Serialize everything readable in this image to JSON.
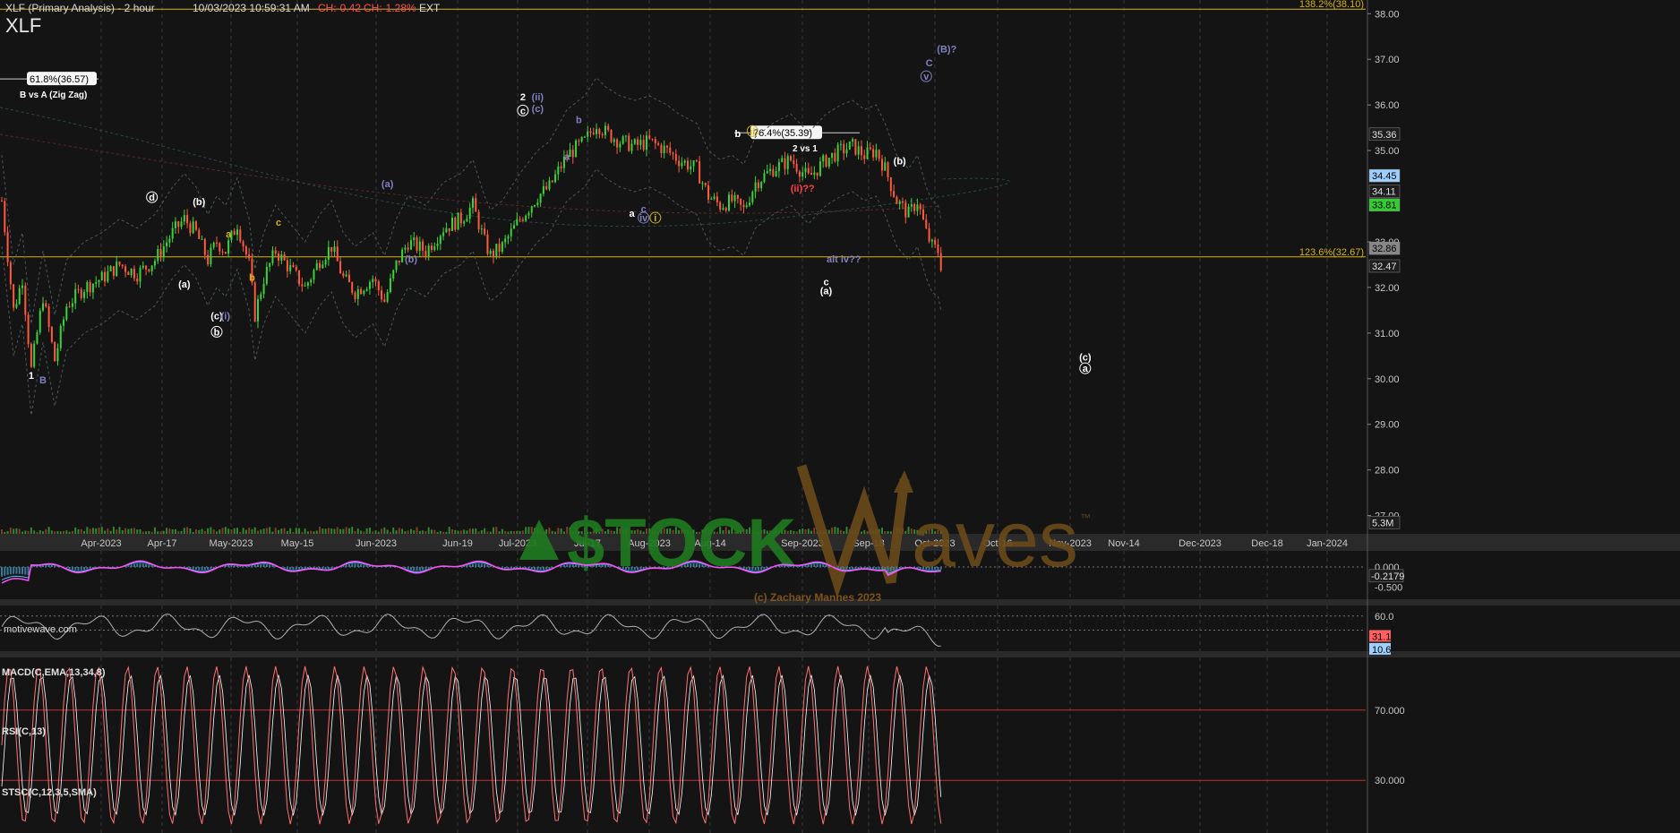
{
  "header": {
    "title": "XLF (Primary Analysis) - 2 hour",
    "timestamp": "10/03/2023 10:59:31 AM",
    "change": "CH:-0.42",
    "change_pct": "CH:-1.28%",
    "session": "EXT",
    "symbol": "XLF"
  },
  "colors": {
    "background": "#141414",
    "up_candle": "#3ad43a",
    "down_candle": "#ff5a3c",
    "fib_line": "#d4b21a",
    "grid": "#3a3a3a",
    "watermark_green": "#1f7a1f",
    "watermark_brown": "#6b4a1a",
    "macd": "#ff4dff",
    "macd_signal": "#4dc3ff",
    "rsi": "#b0b0b0",
    "stoch_k": "#ff7070",
    "stoch_d": "#ffffff",
    "price_up_label": "#8ec8ff",
    "price_green_label": "#33cc33",
    "price_red_label": "#ff6060"
  },
  "chart_data": {
    "type": "candlestick",
    "interval": "2 hour",
    "x_tick_labels": [
      "Apr-2023",
      "Apr-17",
      "May-2023",
      "May-15",
      "Jun-2023",
      "Jun-19",
      "Jul-2023",
      "Jul-17",
      "Aug-2023",
      "Aug-14",
      "Sep-2023",
      "Sep-18",
      "Oct-2023",
      "Oct-16",
      "Nov-2023",
      "Nov-14",
      "Dec-2023",
      "Dec-18",
      "Jan-2024"
    ],
    "y_tick_labels": [
      "38.00",
      "37.00",
      "36.00",
      "35.00",
      "33.00",
      "32.00",
      "31.00",
      "30.00",
      "29.00",
      "28.00",
      "27.00"
    ],
    "ylim": [
      26.6,
      38.3
    ],
    "price_path": [
      [
        0,
        33.9
      ],
      [
        4,
        31.5
      ],
      [
        7,
        32.2
      ],
      [
        10,
        30.2
      ],
      [
        14,
        31.8
      ],
      [
        18,
        30.4
      ],
      [
        22,
        31.6
      ],
      [
        28,
        32.0
      ],
      [
        34,
        32.2
      ],
      [
        40,
        32.5
      ],
      [
        46,
        32.3
      ],
      [
        52,
        32.6
      ],
      [
        58,
        33.2
      ],
      [
        62,
        33.5
      ],
      [
        66,
        33.2
      ],
      [
        70,
        32.6
      ],
      [
        73,
        33.0
      ],
      [
        76,
        32.8
      ],
      [
        80,
        33.4
      ],
      [
        84,
        32.5
      ],
      [
        86,
        31.4
      ],
      [
        89,
        32.2
      ],
      [
        93,
        32.8
      ],
      [
        98,
        32.4
      ],
      [
        103,
        32.0
      ],
      [
        108,
        32.6
      ],
      [
        112,
        32.9
      ],
      [
        116,
        32.2
      ],
      [
        120,
        31.9
      ],
      [
        126,
        32.2
      ],
      [
        130,
        31.7
      ],
      [
        134,
        32.5
      ],
      [
        138,
        33.0
      ],
      [
        144,
        32.8
      ],
      [
        150,
        33.3
      ],
      [
        156,
        33.5
      ],
      [
        160,
        33.8
      ],
      [
        164,
        33.0
      ],
      [
        166,
        32.7
      ],
      [
        170,
        32.9
      ],
      [
        176,
        33.5
      ],
      [
        182,
        34.0
      ],
      [
        186,
        34.2
      ],
      [
        192,
        34.9
      ],
      [
        198,
        35.2
      ],
      [
        202,
        35.6
      ],
      [
        205,
        35.4
      ],
      [
        210,
        35.2
      ],
      [
        215,
        35.1
      ],
      [
        220,
        35.2
      ],
      [
        226,
        35.0
      ],
      [
        230,
        34.8
      ],
      [
        236,
        34.6
      ],
      [
        240,
        34.0
      ],
      [
        244,
        33.8
      ],
      [
        248,
        33.9
      ],
      [
        252,
        33.7
      ],
      [
        256,
        34.3
      ],
      [
        262,
        34.6
      ],
      [
        268,
        34.8
      ],
      [
        274,
        34.4
      ],
      [
        280,
        34.8
      ],
      [
        285,
        35.0
      ],
      [
        289,
        35.1
      ],
      [
        293,
        34.9
      ],
      [
        297,
        35.0
      ],
      [
        300,
        34.6
      ],
      [
        304,
        33.9
      ],
      [
        308,
        33.6
      ],
      [
        311,
        33.9
      ],
      [
        314,
        33.2
      ],
      [
        316,
        32.9
      ],
      [
        318,
        32.8
      ],
      [
        319,
        32.5
      ]
    ],
    "candle_count": 320,
    "projection_days_x": [
      320,
      500
    ],
    "current_price": 32.86,
    "fib_levels": [
      {
        "label": "138.2%(38.10)",
        "value": 38.1
      },
      {
        "label": "123.6%(32.67)",
        "value": 32.67
      },
      {
        "label": "76.4%(35.39)",
        "value": 35.39
      },
      {
        "label": "61.8%(36.57)",
        "value": 36.57
      }
    ],
    "fib_annotations": {
      "two_vs_one": "2 vs 1",
      "b_vs_a": "B vs A (Zig Zag)"
    },
    "right_axis_labels": [
      {
        "text": "35.36",
        "value": 35.36,
        "style": "plain"
      },
      {
        "text": "34.45",
        "value": 34.45,
        "style": "blue"
      },
      {
        "text": "34.11",
        "value": 34.11,
        "style": "plain"
      },
      {
        "text": "33.81",
        "value": 33.81,
        "style": "green"
      },
      {
        "text": "32.86",
        "value": 32.86,
        "style": "grey"
      },
      {
        "text": "32.47",
        "value": 32.47,
        "style": "plain"
      },
      {
        "text": "5.3M",
        "value": 26.85,
        "style": "plain"
      }
    ],
    "wave_labels": [
      {
        "text": "1",
        "x": 10,
        "y": 30.0,
        "color": "#ffffff",
        "circled": false
      },
      {
        "text": "B",
        "x": 14,
        "y": 29.9,
        "color": "#8080c0",
        "circled": false
      },
      {
        "text": "d",
        "x": 51,
        "y": 33.9,
        "color": "#ffffff",
        "circled": true
      },
      {
        "text": "(a)",
        "x": 62,
        "y": 32.0,
        "color": "#ffffff",
        "circled": false
      },
      {
        "text": "(b)",
        "x": 67,
        "y": 33.8,
        "color": "#ffffff",
        "circled": false
      },
      {
        "text": "a",
        "x": 77,
        "y": 33.1,
        "color": "#d4b21a",
        "circled": false
      },
      {
        "text": "(c)",
        "x": 73,
        "y": 31.3,
        "color": "#ffffff",
        "circled": false
      },
      {
        "text": "(i)",
        "x": 76,
        "y": 31.3,
        "color": "#8080c0",
        "circled": false
      },
      {
        "text": "b",
        "x": 73,
        "y": 30.95,
        "color": "#ffffff",
        "circled": true
      },
      {
        "text": "b",
        "x": 85,
        "y": 32.15,
        "color": "#d4b21a",
        "circled": false
      },
      {
        "text": "c",
        "x": 94,
        "y": 33.35,
        "color": "#d4b21a",
        "circled": false
      },
      {
        "text": "(a)",
        "x": 131,
        "y": 34.2,
        "color": "#8080c0",
        "circled": false
      },
      {
        "text": "(b)",
        "x": 139,
        "y": 32.55,
        "color": "#8080c0",
        "circled": false
      },
      {
        "text": "2",
        "x": 177,
        "y": 36.1,
        "color": "#ffffff",
        "circled": false
      },
      {
        "text": "(ii)",
        "x": 182,
        "y": 36.1,
        "color": "#8080c0",
        "circled": false
      },
      {
        "text": "c",
        "x": 177,
        "y": 35.8,
        "color": "#ffffff",
        "circled": true
      },
      {
        "text": "(c)",
        "x": 182,
        "y": 35.85,
        "color": "#8080c0",
        "circled": false
      },
      {
        "text": "a",
        "x": 192,
        "y": 34.8,
        "color": "#8080c0",
        "circled": false
      },
      {
        "text": "b",
        "x": 196,
        "y": 35.6,
        "color": "#8080c0",
        "circled": false
      },
      {
        "text": "a",
        "x": 214,
        "y": 33.55,
        "color": "#ffffff",
        "circled": false
      },
      {
        "text": "c",
        "x": 218,
        "y": 33.65,
        "color": "#8080c0",
        "circled": false
      },
      {
        "text": "iv",
        "x": 218,
        "y": 33.45,
        "color": "#8080c0",
        "circled": true
      },
      {
        "text": "i",
        "x": 222,
        "y": 33.45,
        "color": "#d4b21a",
        "circled": true
      },
      {
        "text": "b",
        "x": 250,
        "y": 35.3,
        "color": "#ffffff",
        "circled": false
      },
      {
        "text": "ii",
        "x": 255,
        "y": 35.35,
        "color": "#d4b21a",
        "circled": true
      },
      {
        "text": "(ii)??",
        "x": 272,
        "y": 34.1,
        "color": "#ff4040",
        "circled": false
      },
      {
        "text": "alt iv??",
        "x": 286,
        "y": 32.55,
        "color": "#8080c0",
        "circled": false
      },
      {
        "text": "c",
        "x": 280,
        "y": 32.05,
        "color": "#ffffff",
        "circled": false
      },
      {
        "text": "(a)",
        "x": 280,
        "y": 31.85,
        "color": "#ffffff",
        "circled": false
      },
      {
        "text": "(b)",
        "x": 305,
        "y": 34.7,
        "color": "#ffffff",
        "circled": false
      },
      {
        "text": "C",
        "x": 315,
        "y": 36.85,
        "color": "#8080c0",
        "circled": false
      },
      {
        "text": "(B)?",
        "x": 321,
        "y": 37.15,
        "color": "#8080c0",
        "circled": false
      },
      {
        "text": "v",
        "x": 314,
        "y": 36.55,
        "color": "#8080c0",
        "circled": true
      },
      {
        "text": "(c)",
        "x": 368,
        "y": 30.4,
        "color": "#ffffff",
        "circled": false
      },
      {
        "text": "a",
        "x": 368,
        "y": 30.15,
        "color": "#ffffff",
        "circled": true
      }
    ],
    "volume_label": "motivewave.com",
    "indicators": [
      {
        "name": "MACD(C,EMA,13,34,8)",
        "ticks": [
          "0.000",
          "-0.500"
        ],
        "value_label": "-0.2179",
        "ylim": [
          -0.8,
          0.4
        ]
      },
      {
        "name": "RSI(C,13)",
        "ticks": [
          "60.0"
        ],
        "value_labels": [
          "31.1",
          "10.6"
        ],
        "ylim": [
          10,
          75
        ]
      },
      {
        "name": "STSC(C,12,3,5,SMA)",
        "ticks": [
          "70.000",
          "30.000"
        ],
        "value_labels": [
          "70.000",
          "30.000"
        ],
        "ylim": [
          0,
          100
        ]
      }
    ]
  },
  "watermark": {
    "brand_left": "$TOCK",
    "brand_right": "aves",
    "tm": "™",
    "credit": "(c) Zachary Mannes 2023"
  }
}
